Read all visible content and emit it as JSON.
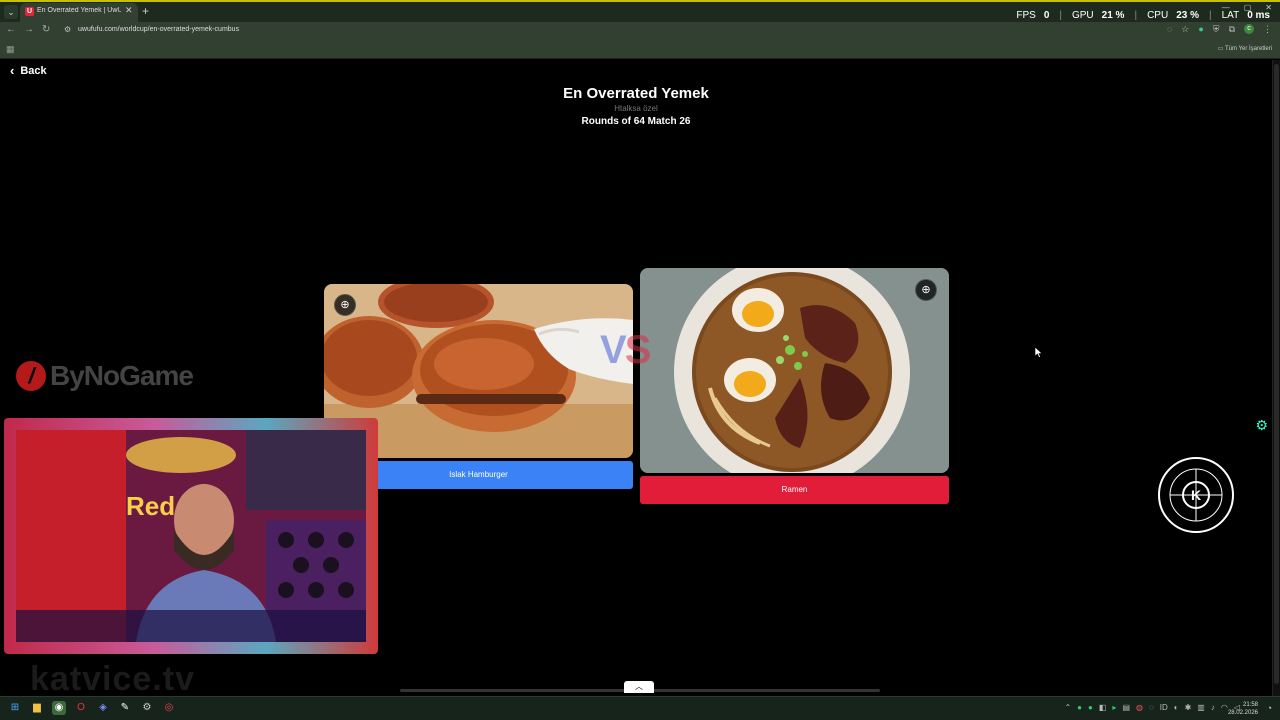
{
  "browser": {
    "tab_menu": "⌄",
    "tab_favicon": "U",
    "tab_title": "En Overrated Yemek | UwUFUFU",
    "tab_close": "✕",
    "new_tab": "+",
    "url": "uwufufu.com/worldcup/en-overrated-yemek-cumbus",
    "bookmarks_all": "Tüm Yer İşaretleri"
  },
  "overlay_stats": {
    "fps_label": "FPS",
    "fps_value": "0",
    "gpu_label": "GPU",
    "gpu_value": "21 %",
    "cpu_label": "CPU",
    "cpu_value": "23 %",
    "lat_label": "LAT",
    "lat_value": "0 ms"
  },
  "page": {
    "back_label": "Back",
    "title": "En Overrated Yemek",
    "subtitle": "Htalksa özel",
    "round_info": "Rounds of 64 Match 26",
    "vs_v": "V",
    "vs_s": "S",
    "left_choice": "Islak Hamburger",
    "right_choice": "Ramen",
    "zoom_icon": "⊕"
  },
  "colors": {
    "left_button": "#3b82f6",
    "right_button": "#e11d3a"
  },
  "watermarks": {
    "bynogame": "ByNoGame",
    "katvice": "katvice.tv"
  },
  "taskbar": {
    "time": "21:58",
    "date": "28.02.2026"
  },
  "icons": {
    "back": "chevron-left-icon",
    "zoom": "zoom-in-icon",
    "start": "windows-start-icon"
  }
}
